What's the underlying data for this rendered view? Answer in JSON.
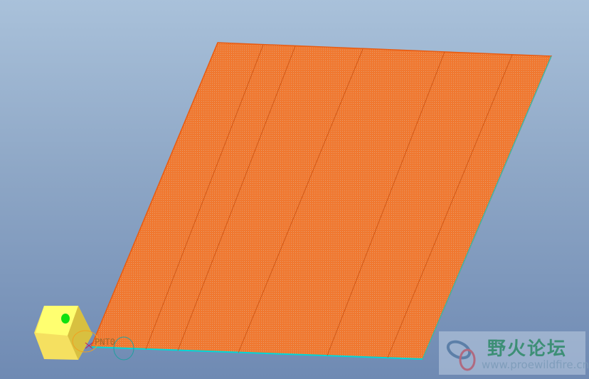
{
  "viewport": {
    "background_top": "#a9c1da",
    "background_bottom": "#6f8ab3"
  },
  "model": {
    "surface_color": "#f07830",
    "edge_color": "#00d8d8",
    "datum_point_label": "PNT0"
  },
  "watermark": {
    "title": "野火论坛",
    "url": "www.proewildfire.cn"
  }
}
